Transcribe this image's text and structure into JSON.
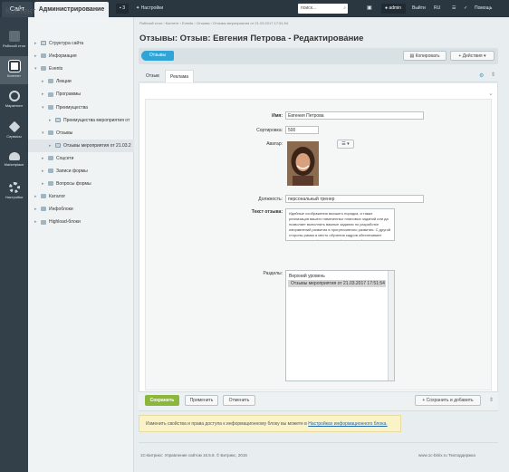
{
  "topbar": {
    "site_tab": "Сайт",
    "admin_tab": "Администрирование",
    "counter": "3",
    "settings": "Настройки",
    "search_placeholder": "поиск...",
    "user": "admin",
    "logout": "Выйти",
    "lang": "RU",
    "help": "Помощь"
  },
  "leftnav": [
    {
      "label": "Рабочий стол",
      "icon": "desktop-icon"
    },
    {
      "label": "Контент",
      "icon": "content-icon",
      "active": true
    },
    {
      "label": "Маркетинг",
      "icon": "target-icon"
    },
    {
      "label": "Сервисы",
      "icon": "layers-icon"
    },
    {
      "label": "Marketplace",
      "icon": "cloud-icon"
    },
    {
      "label": "Настройки",
      "icon": "gear-icon"
    }
  ],
  "tree": {
    "title": "Контент",
    "items": [
      {
        "label": "Структура сайта",
        "depth": 0,
        "arrow": "▸",
        "folder": true
      },
      {
        "label": "Информация",
        "depth": 0,
        "arrow": "▸"
      },
      {
        "label": "Events",
        "depth": 0,
        "arrow": "▾"
      },
      {
        "label": "Лекции",
        "depth": 1,
        "arrow": "▸"
      },
      {
        "label": "Программы",
        "depth": 1,
        "arrow": "▸"
      },
      {
        "label": "Преимущества",
        "depth": 1,
        "arrow": "▾"
      },
      {
        "label": "Преимущества мероприятия от",
        "depth": 2,
        "arrow": "▸",
        "folder": true
      },
      {
        "label": "Отзывы",
        "depth": 1,
        "arrow": "▾"
      },
      {
        "label": "Отзывы мероприятия от 21.03.2",
        "depth": 2,
        "arrow": "▸",
        "folder": true,
        "selected": true
      },
      {
        "label": "Соцсети",
        "depth": 1,
        "arrow": "▸"
      },
      {
        "label": "Записи формы",
        "depth": 1,
        "arrow": "▸"
      },
      {
        "label": "Вопросы формы",
        "depth": 1,
        "arrow": "▸"
      },
      {
        "label": "Каталог",
        "depth": 0,
        "arrow": "▸"
      },
      {
        "label": "Инфоблоки",
        "depth": 0,
        "arrow": "▸"
      },
      {
        "label": "Highload-блоки",
        "depth": 0,
        "arrow": "▸"
      }
    ]
  },
  "breadcrumbs": "Рабочий стол  ›  Контент  ›  Events  ›  Отзывы  ›  Отзывы мероприятия от 21.03.2017 17:51:54",
  "page_title": "Отзывы: Отзыв: Евгения Петрова - Редактирование",
  "toolbar": {
    "back_label": "Отзывы",
    "copy_label": "Копировать",
    "actions_label": "Действия"
  },
  "tabs": [
    "Отзыв",
    "Реклама"
  ],
  "form": {
    "name_label": "Имя:",
    "name_value": "Евгения Петрова",
    "sort_label": "Сортировка:",
    "sort_value": "500",
    "avatar_label": "Аватар:",
    "position_label": "Должность:",
    "position_value": "персональный тренер",
    "review_label": "Текст отзыва:",
    "review_value": "Идейные соображения высшего порядка, а также реализация вашего намеченных плановых заданий или да позволяет выполнять важные задания по разработке направлений развития в прогрессивного развития. С другой стороны рамки и место обучения кадров обеспечивает широкому кругу (специалистов) участие в формировании направлений прогрессивного развития.",
    "sections_label": "Разделы:",
    "sections": [
      "Верхний уровень",
      "  Отзывы мероприятия от 21.03.2017 17:51:54"
    ]
  },
  "buttons": {
    "save": "Сохранить",
    "apply": "Применить",
    "cancel": "Отменить",
    "save_add": "Сохранить и добавить"
  },
  "notice": {
    "text": "Изменить свойства и права доступа к информационному блоку вы можете в ",
    "link": "Настройках информационного блока."
  },
  "footer": {
    "left": "1С-Битрикс: Управление сайтом 16.5.8. © Битрикс, 2016",
    "right": "www.1c-bitrix.ru   Техподдержка"
  }
}
